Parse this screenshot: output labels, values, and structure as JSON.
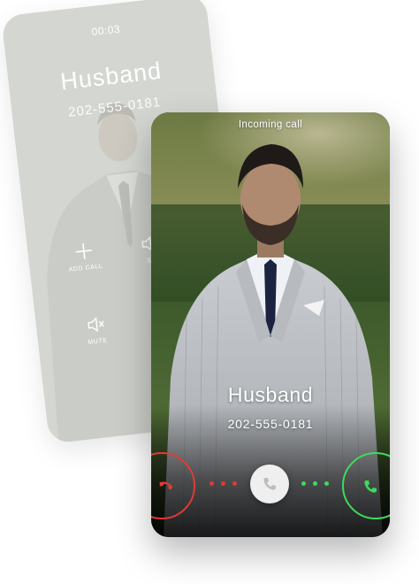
{
  "back_screen": {
    "timer": "00:03",
    "caller_name": "Husband",
    "caller_number": "202-555-0181",
    "actions": [
      {
        "label": "ADD CALL",
        "icon": "add-icon"
      },
      {
        "label": "SP",
        "icon": "speaker-icon"
      },
      {
        "label": "MUTE",
        "icon": "mute-icon"
      }
    ]
  },
  "front_screen": {
    "status": "Incoming call",
    "caller_name": "Husband",
    "caller_number": "202-555-0181",
    "decline_icon": "phone-hangup-icon",
    "accept_icon": "phone-icon",
    "slider_icon": "phone-icon"
  },
  "colors": {
    "decline": "#e53935",
    "accept": "#3ddc5a",
    "text": "#ffffff"
  }
}
